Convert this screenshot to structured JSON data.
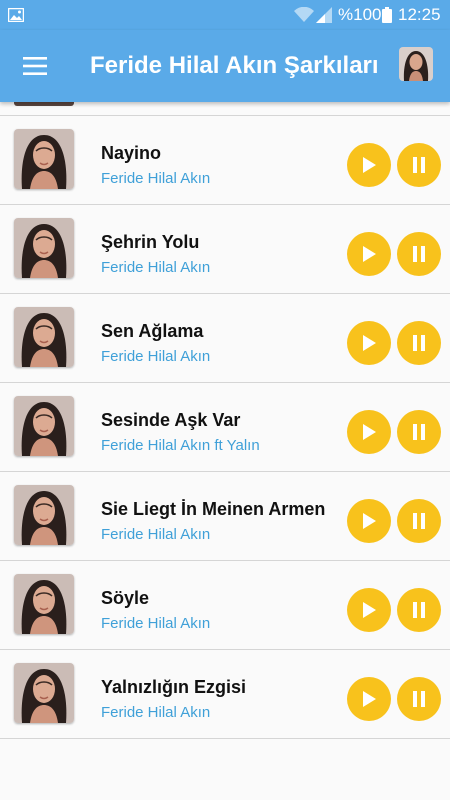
{
  "status_bar": {
    "battery_percent": "%100",
    "time": "12:25"
  },
  "app_bar": {
    "title": "Feride Hilal Akın Şarkıları"
  },
  "songs": [
    {
      "title": "Nayino",
      "artist": "Feride Hilal Akın"
    },
    {
      "title": "Şehrin Yolu",
      "artist": "Feride Hilal Akın"
    },
    {
      "title": "Sen Ağlama",
      "artist": "Feride Hilal Akın"
    },
    {
      "title": "Sesinde Aşk Var",
      "artist": "Feride Hilal Akın ft Yalın"
    },
    {
      "title": "Sie Liegt İn Meinen Armen",
      "artist": "Feride Hilal Akın"
    },
    {
      "title": "Söyle",
      "artist": "Feride Hilal Akın"
    },
    {
      "title": "Yalnızlığın Ezgisi",
      "artist": "Feride Hilal Akın"
    }
  ],
  "colors": {
    "app_bar": "#5aaae8",
    "button": "#f8c21c",
    "artist_text": "#3fa0d8"
  },
  "icons": {
    "menu": "hamburger-menu-icon",
    "play": "play-icon",
    "pause": "pause-icon"
  }
}
